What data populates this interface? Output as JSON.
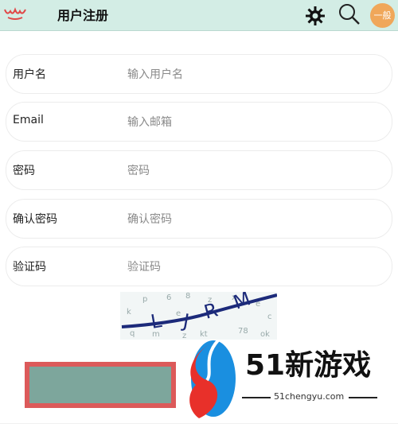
{
  "header": {
    "title": "用户注册",
    "logo_icon": "crown-logo-icon",
    "gear_icon": "gear-icon",
    "search_icon": "search-icon",
    "avatar_text": "一般",
    "avatar_color": "#f0a75a",
    "background": "#d3ede5"
  },
  "form": {
    "fields": [
      {
        "label": "用户名",
        "placeholder": "输入用户名",
        "value": ""
      },
      {
        "label": "Email",
        "placeholder": "输入邮箱",
        "value": ""
      },
      {
        "label": "密码",
        "placeholder": "密码",
        "value": ""
      },
      {
        "label": "确认密码",
        "placeholder": "确认密码",
        "value": ""
      },
      {
        "label": "验证码",
        "placeholder": "验证码",
        "value": ""
      }
    ],
    "captcha_text": "LJRM",
    "submit_fill": "#7da69c",
    "submit_border": "#dc5a5a"
  },
  "watermark": {
    "brand": "51新游戏",
    "url": "51chengyu.com",
    "accent": "#e8302a",
    "accent2": "#1a8fe0"
  }
}
